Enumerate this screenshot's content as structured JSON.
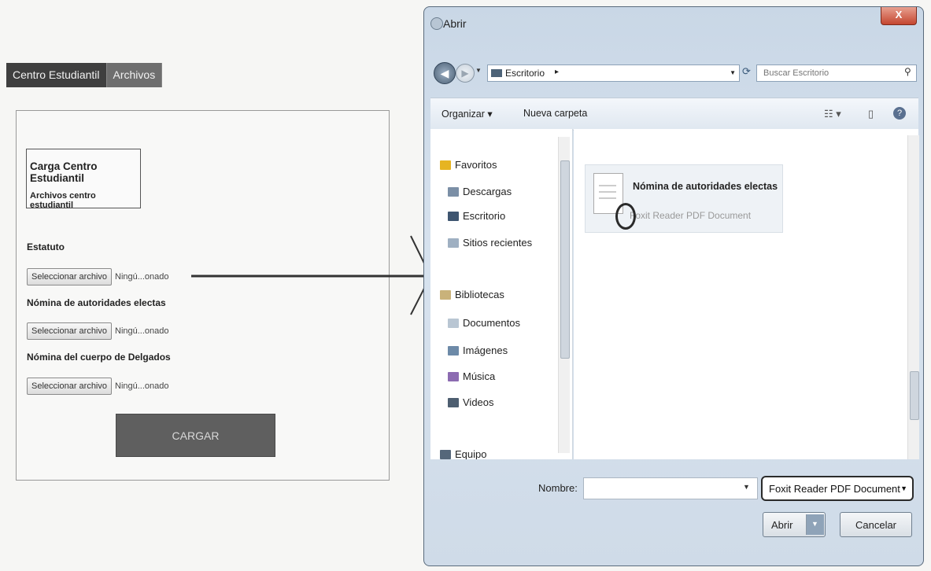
{
  "nav": {
    "items": [
      {
        "label": "Centro Estudiantil"
      },
      {
        "label": "Archivos"
      }
    ]
  },
  "upload": {
    "title": "Carga Centro Estudiantil",
    "subtitle": "Archivos centro estudiantil",
    "fields": [
      {
        "label": "Estatuto",
        "button": "Seleccionar archivo",
        "status": "Ningú...onado"
      },
      {
        "label": "Nómina de autoridades electas",
        "button": "Seleccionar archivo",
        "status": "Ningú...onado"
      },
      {
        "label": "Nómina del cuerpo de Delgados",
        "button": "Seleccionar archivo",
        "status": "Ningú...onado"
      }
    ],
    "submit_label": "CARGAR"
  },
  "dialog": {
    "title": "Abrir",
    "close_label": "X",
    "address": "Escritorio",
    "address_sep": "▸",
    "search_placeholder": "Buscar Escritorio",
    "toolbar": {
      "organize": "Organizar ▾",
      "new_folder": "Nueva carpeta"
    },
    "nav_pane": [
      {
        "label": "Favoritos",
        "icon": "star-icon",
        "color": "#e6b422"
      },
      {
        "label": "Descargas",
        "icon": "download-icon",
        "color": "#7b8fa6"
      },
      {
        "label": "Escritorio",
        "icon": "desktop-icon",
        "color": "#3e5570"
      },
      {
        "label": "Sitios recientes",
        "icon": "recent-icon",
        "color": "#9fb0c2"
      },
      {
        "label": "Bibliotecas",
        "icon": "library-icon",
        "color": "#c9b27a"
      },
      {
        "label": "Documentos",
        "icon": "document-icon",
        "color": "#b9c6d3"
      },
      {
        "label": "Imágenes",
        "icon": "image-icon",
        "color": "#6d8aa8"
      },
      {
        "label": "Música",
        "icon": "music-icon",
        "color": "#8c6bb1"
      },
      {
        "label": "Videos",
        "icon": "video-icon",
        "color": "#4d5e70"
      },
      {
        "label": "Equipo",
        "icon": "computer-icon",
        "color": "#55677a"
      }
    ],
    "file": {
      "name": "Nómina de autoridades electas",
      "type": "Foxit Reader PDF Document"
    },
    "filename_label": "Nombre:",
    "filename_value": "",
    "filter": "Foxit Reader PDF Document",
    "open_label": "Abrir",
    "cancel_label": "Cancelar"
  }
}
